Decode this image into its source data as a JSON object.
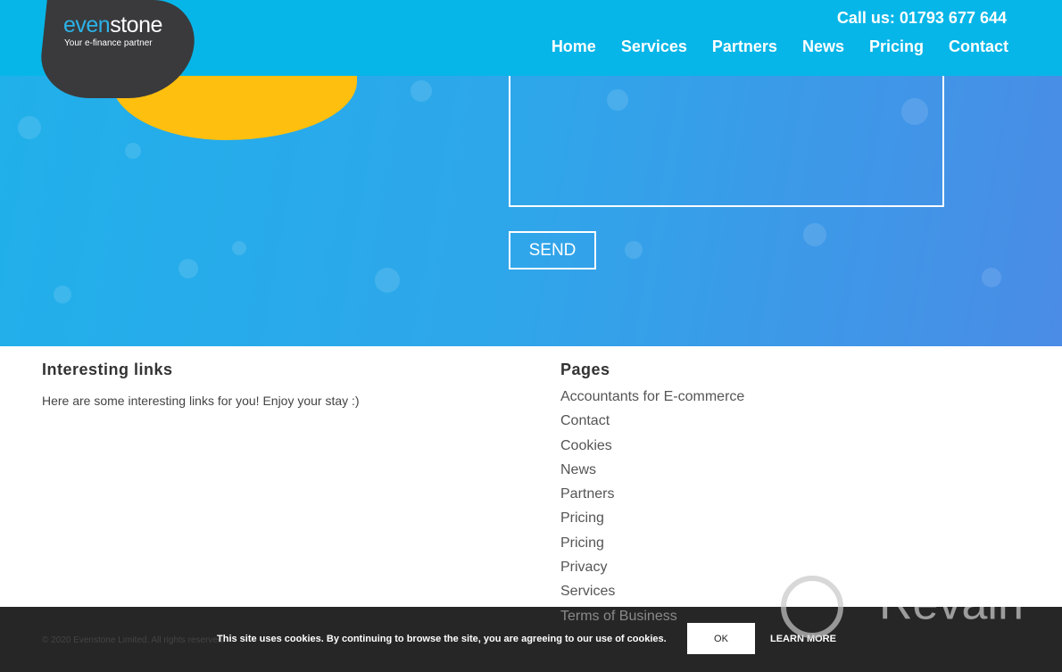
{
  "brand": {
    "name_a": "even",
    "name_b": "stone",
    "tagline": "Your e-finance partner"
  },
  "header": {
    "phone": "Call us: 01793 677 644",
    "nav": [
      "Home",
      "Services",
      "Partners",
      "News",
      "Pricing",
      "Contact"
    ]
  },
  "form": {
    "send_label": "SEND"
  },
  "footer": {
    "links_title": "Interesting links",
    "links_text": "Here are some interesting links for you! Enjoy your stay :)",
    "pages_title": "Pages",
    "pages": [
      "Accountants for E-commerce",
      "Contact",
      "Cookies",
      "News",
      "Partners",
      "Pricing",
      "Pricing",
      "Privacy",
      "Services",
      "Terms of Business"
    ],
    "copyright": "© 2020 Evenstone Limited. All rights reserved."
  },
  "cookie": {
    "text": "This site uses cookies. By continuing to browse the site, you are agreeing to our use of cookies.",
    "ok": "OK",
    "learn_more": "LEARN MORE"
  },
  "watermark": "Revain",
  "colors": {
    "header": "#07b6e8",
    "accent_yellow": "#ffbf0f",
    "logo_dark": "#3a3a3c"
  }
}
